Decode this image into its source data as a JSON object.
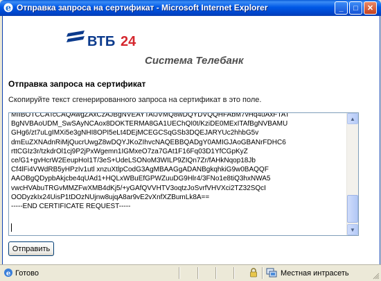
{
  "window": {
    "title": "Отправка запроса на сертификат - Microsoft Internet Explorer",
    "minimize": "_",
    "maximize": "□",
    "close": "✕"
  },
  "logo": {
    "brand": "ВТБ",
    "brand_number": "24",
    "subtitle": "Система Телебанк"
  },
  "page": {
    "heading": "Отправка запроса на сертификат",
    "instruction": "Скопируйте текст сгенерированного запроса на сертификат в это поле.",
    "csr_lines": [
      "MIIBOTCCATcCAQAwgZAxCzAJBgNVEAYTAlJVMQ8wDQYDVQQHFAbM7vHq4uAxFTAT",
      "BgNVBAoUDM_SwSAyNCAox8DOKTERMA8GA1UEChQI0t/KziDE0MExITAfBgNVBAMU",
      "GHg6/zt7uLgIMXi5e3gNHI8OPI5eLt4DEjMCEGCSqGSb3DQEJARYUc2hhbG5v",
      "dmEuZXNAdnRiMjQucrUwgZ8wDQYJKoZIhvcNAQEBBQADgY0AMIGJAoGBANrFDHC6",
      "rttCGIz3r/tzkdrOl1cj9P2jPxWgemn1IGMxeO7za7GAt1F16Fq03D1YfCGpKyZ",
      "ce/G1+gvHcrW2EeupHoI1T/3eS+UdeLSONoM3WILP9ZIQn7Zr/fAHkNqop18Jb",
      "Cf4lFi4VWdRB5yHPzIv1utl xnzuXtlpCodG3AgMBAAGgADANBgkqhkiG9w0BAQQF",
      "AAOBgQDypbAkjcbe4qUAd1+HQLxWBuEfGPWZuuDG9Hlr4/3FNo1e8tiQ3hxNWA5",
      "vwcHVAbuTRGvMMZFwXMB4dKj5/+yGAfQVVHTV3oqtzJoSvrfVHVXci2TZ32SQcI",
      "OODyzkIx24UisP1tDOzNUjnw8ujqA8ar9vE2vXnfXZBumLk8A==",
      "-----END CERTIFICATE REQUEST-----"
    ],
    "send_button": "Отправить"
  },
  "status_bar": {
    "status": "Готово",
    "zone": "Местная интрасеть"
  },
  "colors": {
    "titlebar": "#0058e6",
    "brand_blue": "#0b3a8c",
    "brand_red": "#d5272e"
  }
}
